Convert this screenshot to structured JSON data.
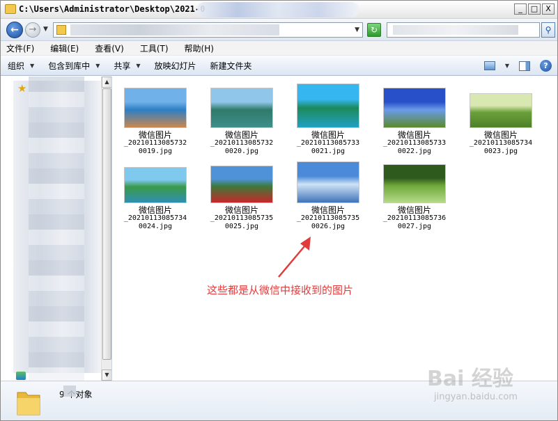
{
  "window": {
    "title": "C:\\Users\\Administrator\\Desktop\\2021-0",
    "controls": {
      "minimize": "_",
      "maximize": "□",
      "close": "X"
    }
  },
  "menubar": {
    "items": [
      "文件(F)",
      "编辑(E)",
      "查看(V)",
      "工具(T)",
      "帮助(H)"
    ]
  },
  "commandbar": {
    "items": [
      {
        "label": "组织",
        "has_arrow": true
      },
      {
        "label": "包含到库中",
        "has_arrow": true
      },
      {
        "label": "共享",
        "has_arrow": true
      },
      {
        "label": "放映幻灯片",
        "has_arrow": false
      },
      {
        "label": "新建文件夹",
        "has_arrow": false
      }
    ],
    "help": "?"
  },
  "files": [
    {
      "label": "微信图片",
      "name_line1": "_20210113085732",
      "name_line2": "0019.jpg",
      "palette": [
        "#6fb1e8",
        "#2e7fc4",
        "#c9874e"
      ]
    },
    {
      "label": "微信图片",
      "name_line1": "_20210113085732",
      "name_line2": "0020.jpg",
      "palette": [
        "#8fc6e9",
        "#2f7a6a",
        "#3e8e8a"
      ]
    },
    {
      "label": "微信图片",
      "name_line1": "_20210113085733",
      "name_line2": "0021.jpg",
      "palette": [
        "#35b6f0",
        "#1c8a5c",
        "#21a0c2"
      ]
    },
    {
      "label": "微信图片",
      "name_line1": "_20210113085733",
      "name_line2": "0022.jpg",
      "palette": [
        "#2850c8",
        "#6a9bea",
        "#5a8a2a"
      ]
    },
    {
      "label": "微信图片",
      "name_line1": "_20210113085734",
      "name_line2": "0023.jpg",
      "palette": [
        "#d9e7b0",
        "#6aa03a",
        "#4f7f2a"
      ]
    },
    {
      "label": "微信图片",
      "name_line1": "_20210113085734",
      "name_line2": "0024.jpg",
      "palette": [
        "#7fc9ef",
        "#3a9a4a",
        "#2f8fb0"
      ]
    },
    {
      "label": "微信图片",
      "name_line1": "_20210113085735",
      "name_line2": "0025.jpg",
      "palette": [
        "#4f92d8",
        "#3d7a3a",
        "#c8262a"
      ]
    },
    {
      "label": "微信图片",
      "name_line1": "_20210113085735",
      "name_line2": "0026.jpg",
      "palette": [
        "#4a8ad8",
        "#cfe3f5",
        "#3f73b8"
      ]
    },
    {
      "label": "微信图片",
      "name_line1": "_20210113085736",
      "name_line2": "0027.jpg",
      "palette": [
        "#2f5a1e",
        "#6fa83a",
        "#b5d98a"
      ]
    }
  ],
  "annotation": {
    "text": "这些都是从微信中接收到的图片",
    "color": "#e23b3b"
  },
  "status": {
    "count_text": "9 个对象"
  },
  "watermark": {
    "main": "Bai 经验",
    "sub": "jingyan.baidu.com"
  }
}
